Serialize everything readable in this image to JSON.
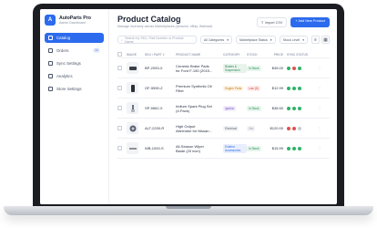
{
  "app": {
    "name": "AutoParts Pro",
    "subtitle": "Admin Dashboard",
    "logo": "A"
  },
  "sidebar": {
    "items": [
      {
        "label": "Catalog",
        "icon": "grid-icon",
        "active": true
      },
      {
        "label": "Orders",
        "icon": "cart-icon",
        "badge": "12"
      },
      {
        "label": "Sync Settings",
        "icon": "sync-icon"
      },
      {
        "label": "Analytics",
        "icon": "chart-icon"
      },
      {
        "label": "Store Settings",
        "icon": "gear-icon"
      }
    ]
  },
  "header": {
    "title": "Product Catalog",
    "subtitle": "Manage inventory across Marketplaces (Amazon, eBay, Walmart)",
    "import_label": "Import CSV",
    "add_label": "+ Add New Product"
  },
  "filters": {
    "search_placeholder": "Search by SKU, Part Number or Product Name",
    "category": "All Categories",
    "marketplace": "Marketplace Status",
    "sort": "Stock Level"
  },
  "table": {
    "headers": [
      "IMAGE",
      "SKU / PART #",
      "PRODUCT NAME",
      "CATEGORY",
      "STOCK",
      "PRICE",
      "SYNC STATUS"
    ],
    "rows": [
      {
        "sku": "BP-2093-X",
        "name": [
          "Ceramic Brake Pads",
          "for Ford F-150 (2015..."
        ],
        "category": "Brakes & Suspension",
        "cat_color": "#e8f3ec",
        "cat_text": "#2f8a56",
        "stock": "In Stock",
        "stock_bg": "#e6f5ec",
        "stock_fg": "#2f8a56",
        "price": "$45.00",
        "sync": [
          "#2fb36b",
          "#e05252",
          "#2fb36b"
        ]
      },
      {
        "sku": "OF-5590-Z",
        "name": [
          "Premium Synthetic Oil",
          "Filter"
        ],
        "category": "Engine Parts",
        "cat_color": "#fdf3e4",
        "cat_text": "#c27a1c",
        "stock": "Low (5)",
        "stock_bg": "#fdecea",
        "stock_fg": "#d0443a",
        "price": "$12.99",
        "sync": [
          "#2fb36b",
          "#2fb36b",
          "#2fb36b"
        ]
      },
      {
        "sku": "SP-5562-X",
        "name": [
          "Iridium Spark Plug Set",
          "(4-Pack)"
        ],
        "category": "Ignition",
        "cat_color": "#f1ecfb",
        "cat_text": "#7a55c9",
        "stock": "In Stock",
        "stock_bg": "#e6f5ec",
        "stock_fg": "#2f8a56",
        "price": "$38.50",
        "sync": [
          "#2fb36b",
          "#2fb36b",
          "#2fb36b"
        ]
      },
      {
        "sku": "ALT-2200-R",
        "name": [
          "High Output",
          "Alternator for Nissan..."
        ],
        "category": "Electrical",
        "cat_color": "#f2f3f5",
        "cat_text": "#5b6473",
        "stock": "Out",
        "stock_bg": "#f2f3f5",
        "stock_fg": "#8a93a6",
        "price": "$120.00",
        "sync": [
          "#e05252",
          "#e05252",
          "#c7ccd5"
        ]
      },
      {
        "sku": "WB-1000-S",
        "name": [
          "All-Season Wiper",
          "Blade (20 inch)"
        ],
        "category": "Exterior Accessories",
        "cat_color": "#e8eefc",
        "cat_text": "#2c6bed",
        "stock": "In Stock",
        "stock_bg": "#e6f5ec",
        "stock_fg": "#2f8a56",
        "price": "$15.99",
        "sync": [
          "#2fb36b",
          "#2fb36b",
          "#2fb36b"
        ]
      }
    ]
  }
}
